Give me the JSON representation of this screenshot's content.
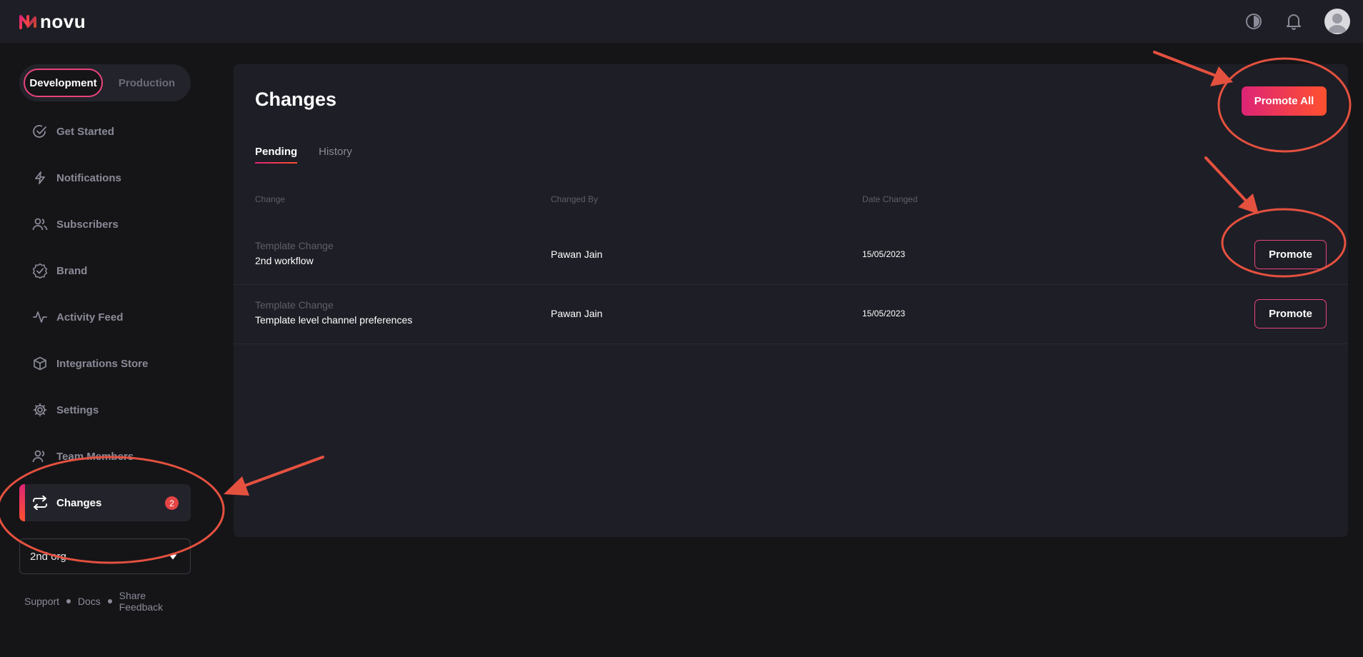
{
  "header": {
    "logo_text": "novu",
    "icons": [
      "theme-toggle-icon",
      "bell-icon",
      "avatar"
    ]
  },
  "sidebar": {
    "env": {
      "development": "Development",
      "production": "Production",
      "selected": "Development"
    },
    "items": [
      {
        "label": "Get Started",
        "icon": "check-circle-icon"
      },
      {
        "label": "Notifications",
        "icon": "bolt-icon"
      },
      {
        "label": "Subscribers",
        "icon": "users-icon"
      },
      {
        "label": "Brand",
        "icon": "badge-check-icon"
      },
      {
        "label": "Activity Feed",
        "icon": "activity-icon"
      },
      {
        "label": "Integrations Store",
        "icon": "box-icon"
      },
      {
        "label": "Settings",
        "icon": "gear-icon"
      },
      {
        "label": "Team Members",
        "icon": "team-icon"
      },
      {
        "label": "Changes",
        "icon": "swap-icon",
        "badge": "2",
        "active": true
      }
    ],
    "org": {
      "value": "2nd org"
    },
    "footer": {
      "support": "Support",
      "docs": "Docs",
      "feedback": "Share Feedback"
    }
  },
  "main": {
    "title": "Changes",
    "promote_all_label": "Promote All",
    "tabs": [
      {
        "label": "Pending",
        "active": true
      },
      {
        "label": "History",
        "active": false
      }
    ],
    "columns": {
      "change": "Change",
      "changed_by": "Changed By",
      "date_changed": "Date Changed"
    },
    "rows": [
      {
        "type": "Template Change",
        "name": "2nd workflow",
        "changed_by": "Pawan Jain",
        "date": "15/05/2023",
        "action": "Promote"
      },
      {
        "type": "Template Change",
        "name": "Template level channel preferences",
        "changed_by": "Pawan Jain",
        "date": "15/05/2023",
        "action": "Promote"
      }
    ]
  },
  "colors": {
    "accent_start": "#dd2476",
    "accent_end": "#ff512f",
    "annotation": "#e5513f",
    "background": "#151518",
    "panel": "#1e1e26"
  }
}
